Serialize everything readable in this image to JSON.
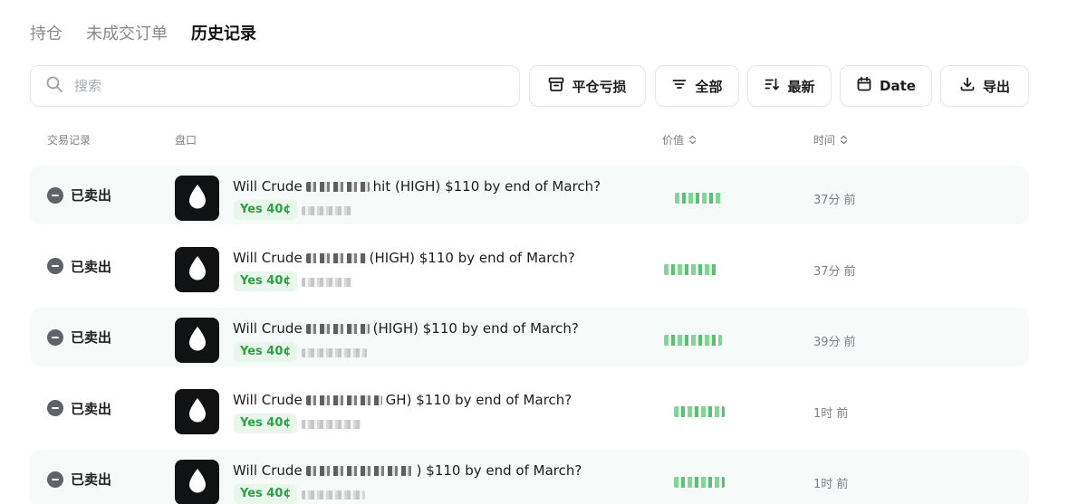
{
  "tabs": [
    {
      "label": "持仓",
      "active": false
    },
    {
      "label": "未成交订单",
      "active": false
    },
    {
      "label": "历史记录",
      "active": true
    }
  ],
  "search": {
    "placeholder": "搜索",
    "value": ""
  },
  "toolbar": {
    "pnl_label": "平仓亏损",
    "filter_label": "全部",
    "sort_label": "最新",
    "date_label": "Date",
    "export_label": "导出"
  },
  "headers": {
    "trade": "交易记录",
    "market": "盘口",
    "value": "价值",
    "time": "时间"
  },
  "rows": [
    {
      "status": "已卖出",
      "title_start": "Will Crude",
      "title_end": "hit (HIGH) $110 by end of March?",
      "outcome": "Yes 40¢",
      "time": "37分 前"
    },
    {
      "status": "已卖出",
      "title_start": "Will Crude",
      "title_end": "(HIGH) $110 by end of March?",
      "outcome": "Yes 40¢",
      "time": "37分 前"
    },
    {
      "status": "已卖出",
      "title_start": "Will Crude",
      "title_end": "(HIGH) $110 by end of March?",
      "outcome": "Yes 40¢",
      "time": "39分 前"
    },
    {
      "status": "已卖出",
      "title_start": "Will Crude",
      "title_end": "GH) $110 by end of March?",
      "outcome": "Yes 40¢",
      "time": "1时 前"
    },
    {
      "status": "已卖出",
      "title_start": "Will Crude",
      "title_end": ") $110 by end of March?",
      "outcome": "Yes 40¢",
      "time": "1时 前"
    }
  ],
  "colors": {
    "accent_green": "#2f9e44",
    "row_shade": "#f6faf9",
    "logo_bg": "#101214"
  },
  "icons": {
    "search": "search-icon",
    "pnl": "archive-box-icon",
    "filter": "filter-lines-icon",
    "sort": "sort-icon",
    "date": "calendar-icon",
    "export": "download-icon",
    "status": "minus-circle-icon",
    "market_logo": "oil-drop-icon"
  }
}
